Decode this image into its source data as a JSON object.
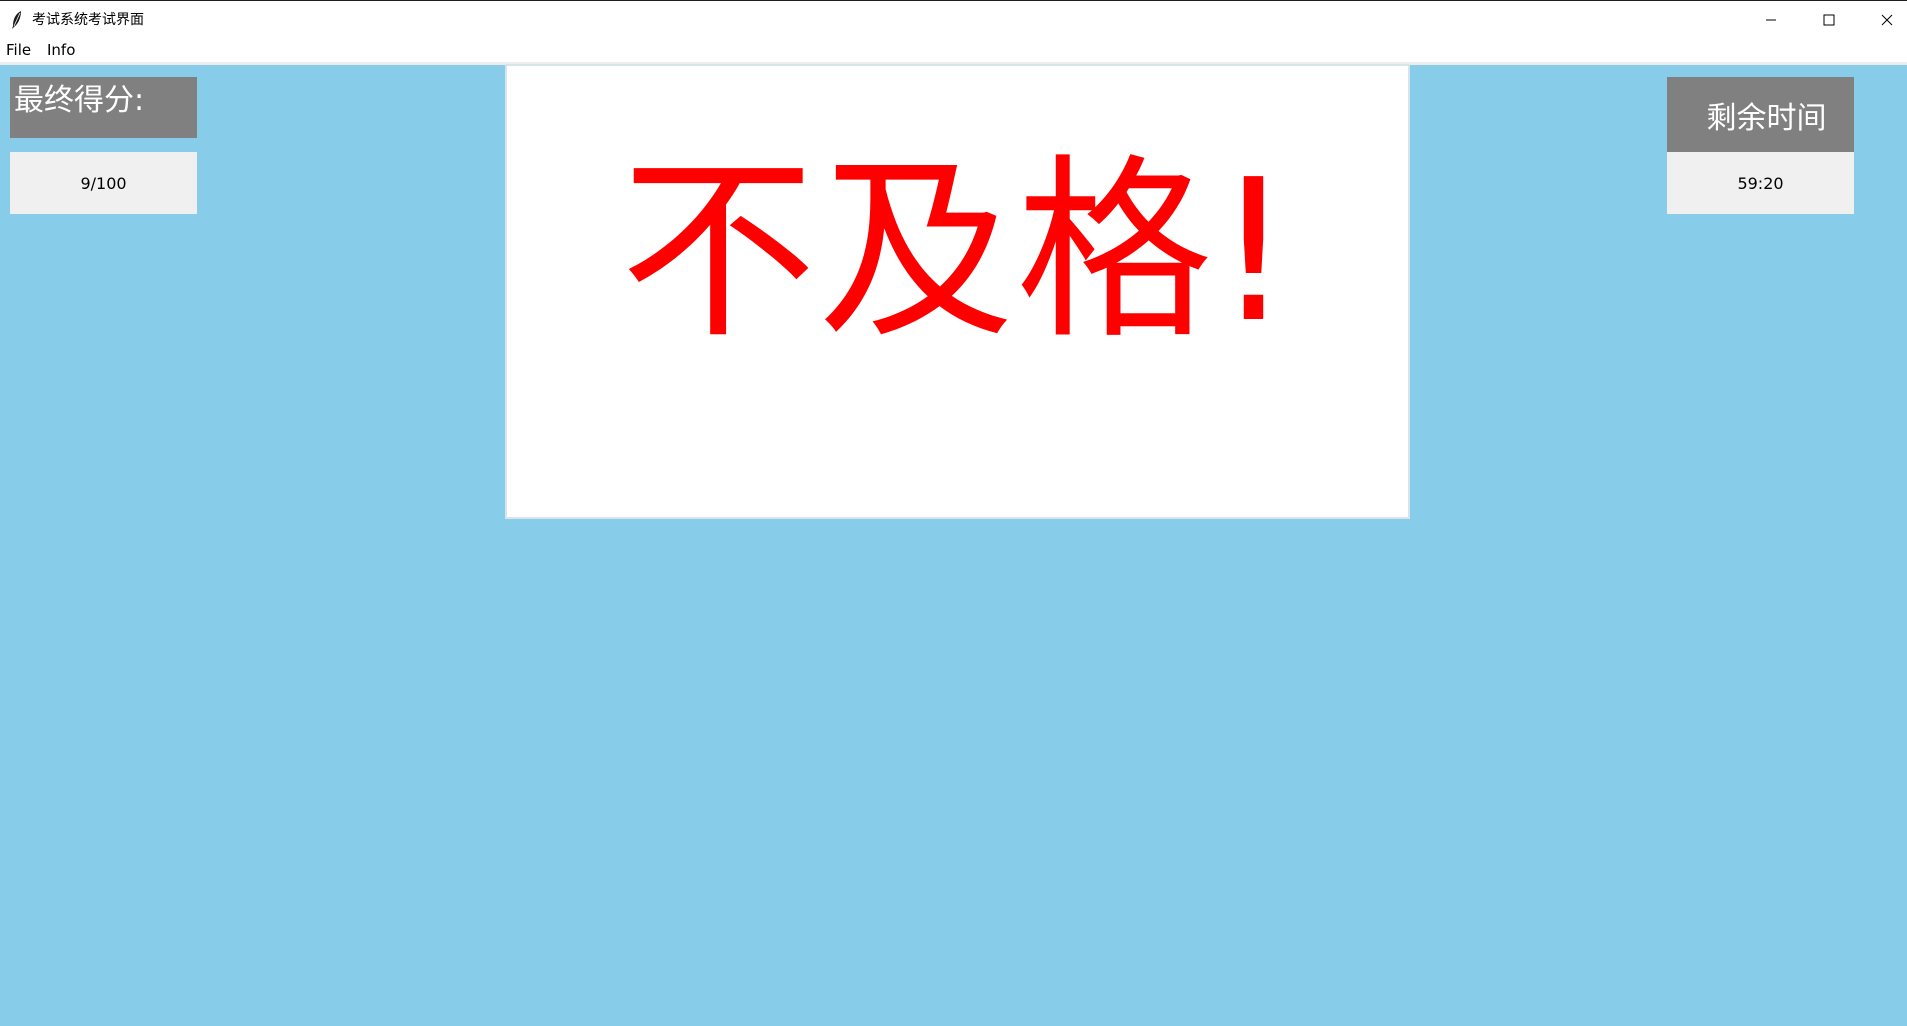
{
  "window": {
    "title": "考试系统考试界面",
    "icon": "feather-icon",
    "controls": {
      "minimize_icon": "minimize-icon",
      "maximize_icon": "maximize-icon",
      "close_icon": "close-icon"
    }
  },
  "menu": {
    "items": [
      {
        "label": "File"
      },
      {
        "label": "Info"
      }
    ]
  },
  "score": {
    "label": "最终得分:",
    "value": "9/100"
  },
  "timer": {
    "label": "剩余时间",
    "value": "59:20"
  },
  "result": {
    "text": "不及格!"
  },
  "colors": {
    "background": "#87cdea",
    "header_gray": "#808080",
    "value_bg": "#f0f0f0",
    "result_text": "#fe0000",
    "panel_bg": "#ffffff"
  }
}
